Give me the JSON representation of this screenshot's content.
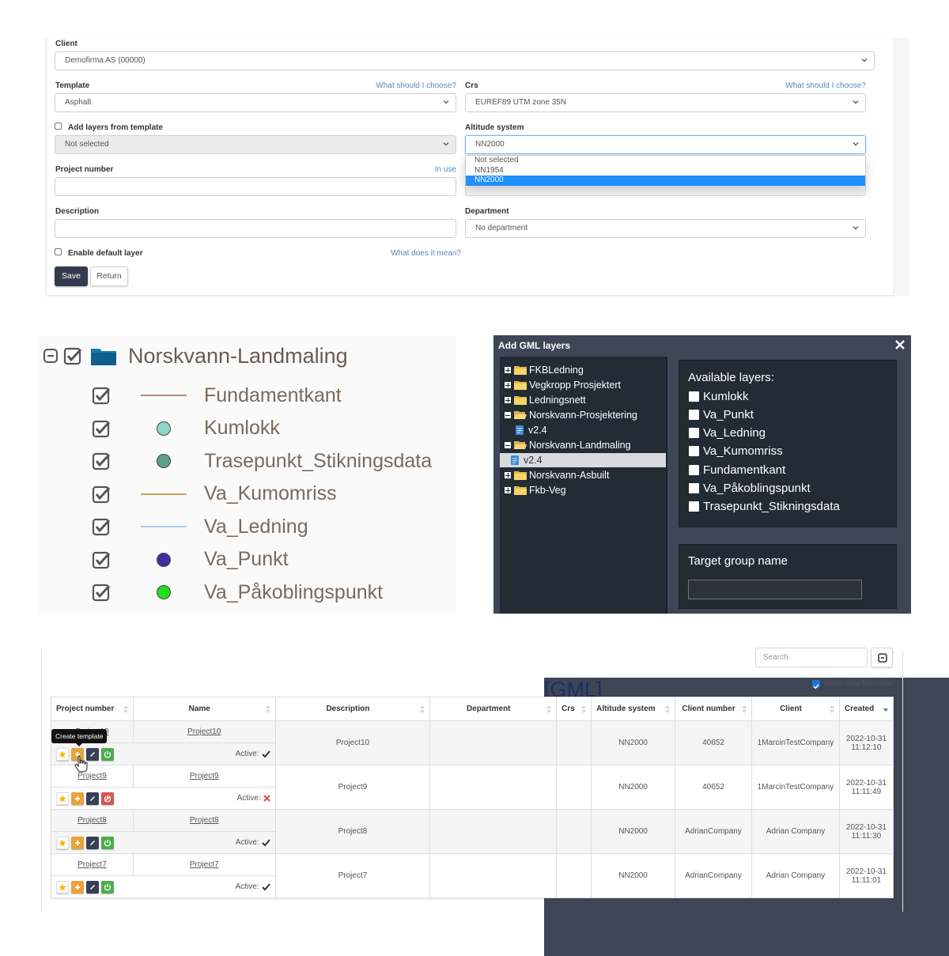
{
  "project_form": {
    "client": {
      "label": "Client",
      "value": "Demofirma AS (00000)"
    },
    "template": {
      "label": "Template",
      "help_link": "What should I choose?",
      "value": "Asphalt"
    },
    "crs": {
      "label": "Crs",
      "help_link": "What should I choose?",
      "value": "EUREF89 UTM zone 35N"
    },
    "add_layers": {
      "label": "Add layers from template",
      "checked": false,
      "value": "Not selected"
    },
    "altitude_system": {
      "label": "Altitude system",
      "value": "NN2000",
      "options": [
        "Not selected",
        "NN1954",
        "NN2000"
      ],
      "highlighted_option": "NN2000"
    },
    "project_number": {
      "label": "Project number",
      "status_link": "In use",
      "value": ""
    },
    "description": {
      "label": "Description",
      "value": ""
    },
    "department": {
      "label": "Department",
      "value": "No department"
    },
    "enable_default_layer": {
      "label": "Enable default layer",
      "checked": false,
      "help_link": "What does it mean?"
    },
    "buttons": {
      "save": "Save",
      "return": "Return"
    }
  },
  "layer_legend": {
    "group": {
      "name": "Norskvann-Landmaling",
      "tag": "[GML]",
      "checked": true,
      "expanded": true
    },
    "layers": [
      {
        "name": "Fundamentkant",
        "symbol": "line",
        "color": "#b5877a",
        "checked": true
      },
      {
        "name": "Kumlokk",
        "symbol": "point",
        "color": "#8fd6c9",
        "checked": true
      },
      {
        "name": "Trasepunkt_Stikningsdata",
        "symbol": "point",
        "color": "#5e9e8c",
        "checked": true
      },
      {
        "name": "Va_Kumomriss",
        "symbol": "line",
        "color": "#c4a95c",
        "checked": true
      },
      {
        "name": "Va_Ledning",
        "symbol": "line",
        "color": "#a9cdee",
        "checked": true
      },
      {
        "name": "Va_Punkt",
        "symbol": "point",
        "color": "#3d2f9e",
        "checked": true
      },
      {
        "name": "Va_Påkoblingspunkt",
        "symbol": "point",
        "color": "#22dd22",
        "checked": true
      }
    ]
  },
  "gml_dialog": {
    "title": "Add GML layers",
    "tree": [
      {
        "label": "FKBLedning",
        "type": "folder",
        "expanded": false,
        "level": 0
      },
      {
        "label": "Vegkropp Prosjektert",
        "type": "folder",
        "expanded": false,
        "level": 0
      },
      {
        "label": "Ledningsnett",
        "type": "folder",
        "expanded": false,
        "level": 0
      },
      {
        "label": "Norskvann-Prosjektering",
        "type": "folder",
        "expanded": true,
        "level": 0
      },
      {
        "label": "v2.4",
        "type": "file",
        "level": 1,
        "selected": false
      },
      {
        "label": "Norskvann-Landmaling",
        "type": "folder",
        "expanded": true,
        "level": 0
      },
      {
        "label": "v2.4",
        "type": "file",
        "level": 1,
        "selected": true
      },
      {
        "label": "Norskvann-Asbuilt",
        "type": "folder",
        "expanded": false,
        "level": 0
      },
      {
        "label": "Fkb-Veg",
        "type": "folder",
        "expanded": false,
        "level": 0
      }
    ],
    "available_title": "Available layers:",
    "available_layers": [
      "Kumlokk",
      "Va_Punkt",
      "Va_Ledning",
      "Va_Kumomriss",
      "Fundamentkant",
      "Va_Påkoblingspunkt",
      "Trasepunkt_Stikningsdata"
    ],
    "target_group_label": "Target group name",
    "target_group_value": ""
  },
  "project_table": {
    "search_placeholder": "Search",
    "show_only_favourite": {
      "label": "Show only favourite",
      "checked": true
    },
    "tooltip": "Create template",
    "active_label": "Active:",
    "columns": [
      "Project number",
      "Name",
      "Description",
      "Department",
      "Crs",
      "Altitude system",
      "Client number",
      "Client",
      "Created"
    ],
    "rows": [
      {
        "project_number": "Project10",
        "name": "Project10",
        "description": "Project10",
        "department": "",
        "crs": "",
        "altitude_system": "NN2000",
        "client_number": "40652",
        "client": "1MarcinTestCompany",
        "created_date": "2022-10-31",
        "created_time": "11:12:10",
        "active": true
      },
      {
        "project_number": "Project9",
        "name": "Project9",
        "description": "Project9",
        "department": "",
        "crs": "",
        "altitude_system": "NN2000",
        "client_number": "40652",
        "client": "1MarcinTestCompany",
        "created_date": "2022-10-31",
        "created_time": "11:11:49",
        "active": false
      },
      {
        "project_number": "Project8",
        "name": "Project8",
        "description": "Project8",
        "department": "",
        "crs": "",
        "altitude_system": "NN2000",
        "client_number": "AdrianCompany",
        "client": "Adrian Company",
        "created_date": "2022-10-31",
        "created_time": "11:11:30",
        "active": true
      },
      {
        "project_number": "Project7",
        "name": "Project7",
        "description": "Project7",
        "department": "",
        "crs": "",
        "altitude_system": "NN2000",
        "client_number": "AdrianCompany",
        "client": "Adrian Company",
        "created_date": "2022-10-31",
        "created_time": "11:11:01",
        "active": true
      }
    ],
    "sorted_column": "Created"
  }
}
